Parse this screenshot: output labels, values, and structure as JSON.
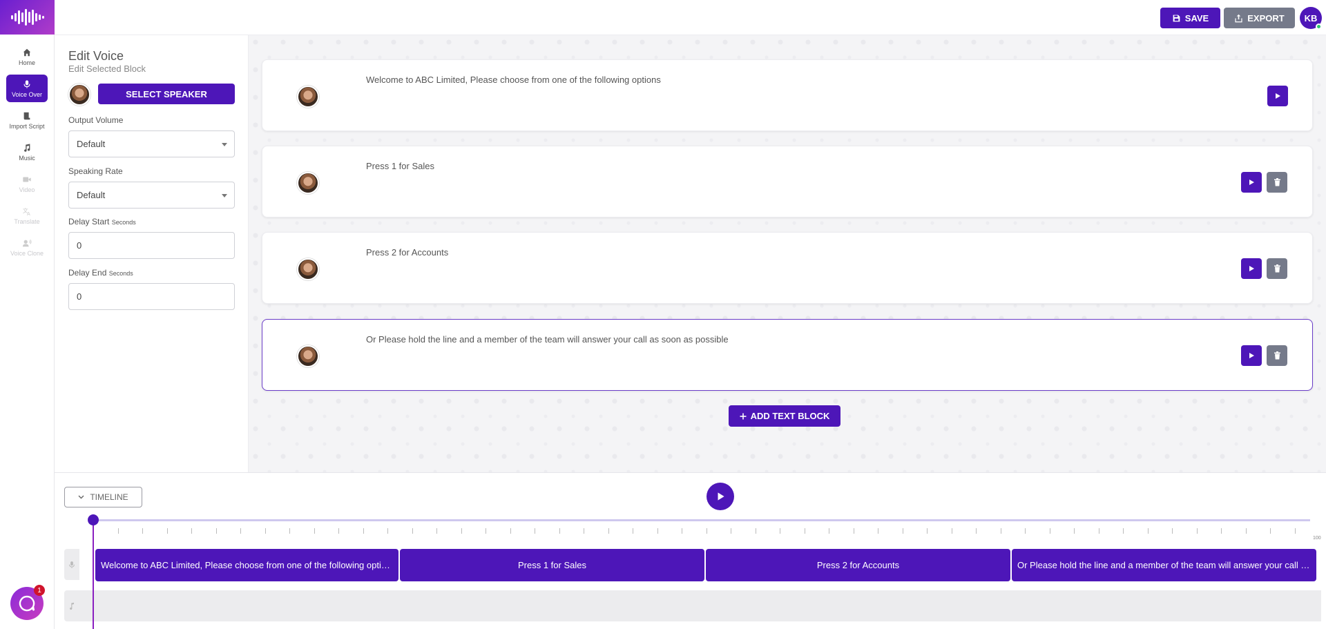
{
  "nav": {
    "items": [
      {
        "label": "Home",
        "icon": "home-icon",
        "active": false,
        "disabled": false
      },
      {
        "label": "Voice Over",
        "icon": "microphone-icon",
        "active": true,
        "disabled": false
      },
      {
        "label": "Import Script",
        "icon": "script-icon",
        "active": false,
        "disabled": false
      },
      {
        "label": "Music",
        "icon": "music-note-icon",
        "active": false,
        "disabled": false
      },
      {
        "label": "Video",
        "icon": "video-icon",
        "active": false,
        "disabled": true
      },
      {
        "label": "Translate",
        "icon": "translate-icon",
        "active": false,
        "disabled": true
      },
      {
        "label": "Voice Clone",
        "icon": "voice-clone-icon",
        "active": false,
        "disabled": true
      }
    ]
  },
  "header": {
    "save_label": "SAVE",
    "export_label": "EXPORT",
    "avatar_initials": "KB"
  },
  "panel": {
    "title": "Edit Voice",
    "subtitle": "Edit Selected Block",
    "select_speaker_label": "SELECT SPEAKER",
    "output_volume_label": "Output Volume",
    "output_volume_value": "Default",
    "speaking_rate_label": "Speaking Rate",
    "speaking_rate_value": "Default",
    "delay_start_label": "Delay Start",
    "delay_start_unit": "Seconds",
    "delay_start_value": "0",
    "delay_end_label": "Delay End",
    "delay_end_unit": "Seconds",
    "delay_end_value": "0"
  },
  "blocks": [
    {
      "text": "Welcome to ABC Limited, Please choose from one of the following options"
    },
    {
      "text": "Press 1 for Sales"
    },
    {
      "text": "Press 2 for Accounts"
    },
    {
      "text": "Or Please hold the line and a member of the team will answer your call as soon as possible"
    }
  ],
  "add_block_label": "ADD TEXT BLOCK",
  "timeline": {
    "toggle_label": "TIMELINE",
    "ruler_end_label": "100",
    "clips": [
      "Welcome to ABC Limited, Please choose from one of the following options",
      "Press 1 for Sales",
      "Press 2 for Accounts",
      "Or Please hold the line and a member of the team will answer your call as soon as possible"
    ]
  },
  "chat": {
    "badge": "1"
  },
  "colors": {
    "accent": "#4d16b8",
    "secondary": "#757a8a",
    "online": "#2bc46e"
  }
}
